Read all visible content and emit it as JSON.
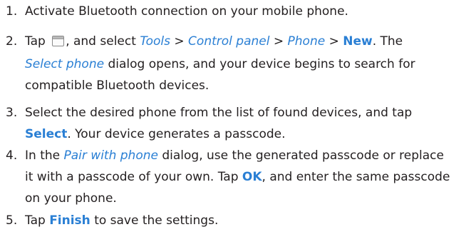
{
  "steps": [
    {
      "num": "1.",
      "text": "Activate Bluetooth connection on your mobile phone."
    },
    {
      "num": "2.",
      "tap": "Tap",
      "after_icon": ", and select",
      "tools": "Tools",
      "gt": ">",
      "control_panel": "Control panel",
      "phone": "Phone",
      "new": "New",
      "the": ". The",
      "select_phone": "Select phone",
      "line2_rest": "dialog opens, and your device begins to search for",
      "line3": "compatible Bluetooth devices."
    },
    {
      "num": "3.",
      "line1": "Select the desired phone from the list of found devices, and tap",
      "select": "Select",
      "line2_rest": ". Your device generates a passcode."
    },
    {
      "num": "4.",
      "in_the": "In the",
      "pair_with_phone": "Pair with phone",
      "line1_rest": "dialog, use the generated passcode or replace",
      "line2_start": "it with a passcode of your own. Tap",
      "ok": "OK",
      "line2_rest": ", and enter the same passcode",
      "line3": "on your phone."
    },
    {
      "num": "5.",
      "tap": "Tap",
      "finish": "Finish",
      "rest": "to save the settings."
    }
  ],
  "icons": {
    "menu_icon": "menu-icon"
  },
  "colors": {
    "text": "#231f20",
    "accent": "#2a7fd4"
  }
}
